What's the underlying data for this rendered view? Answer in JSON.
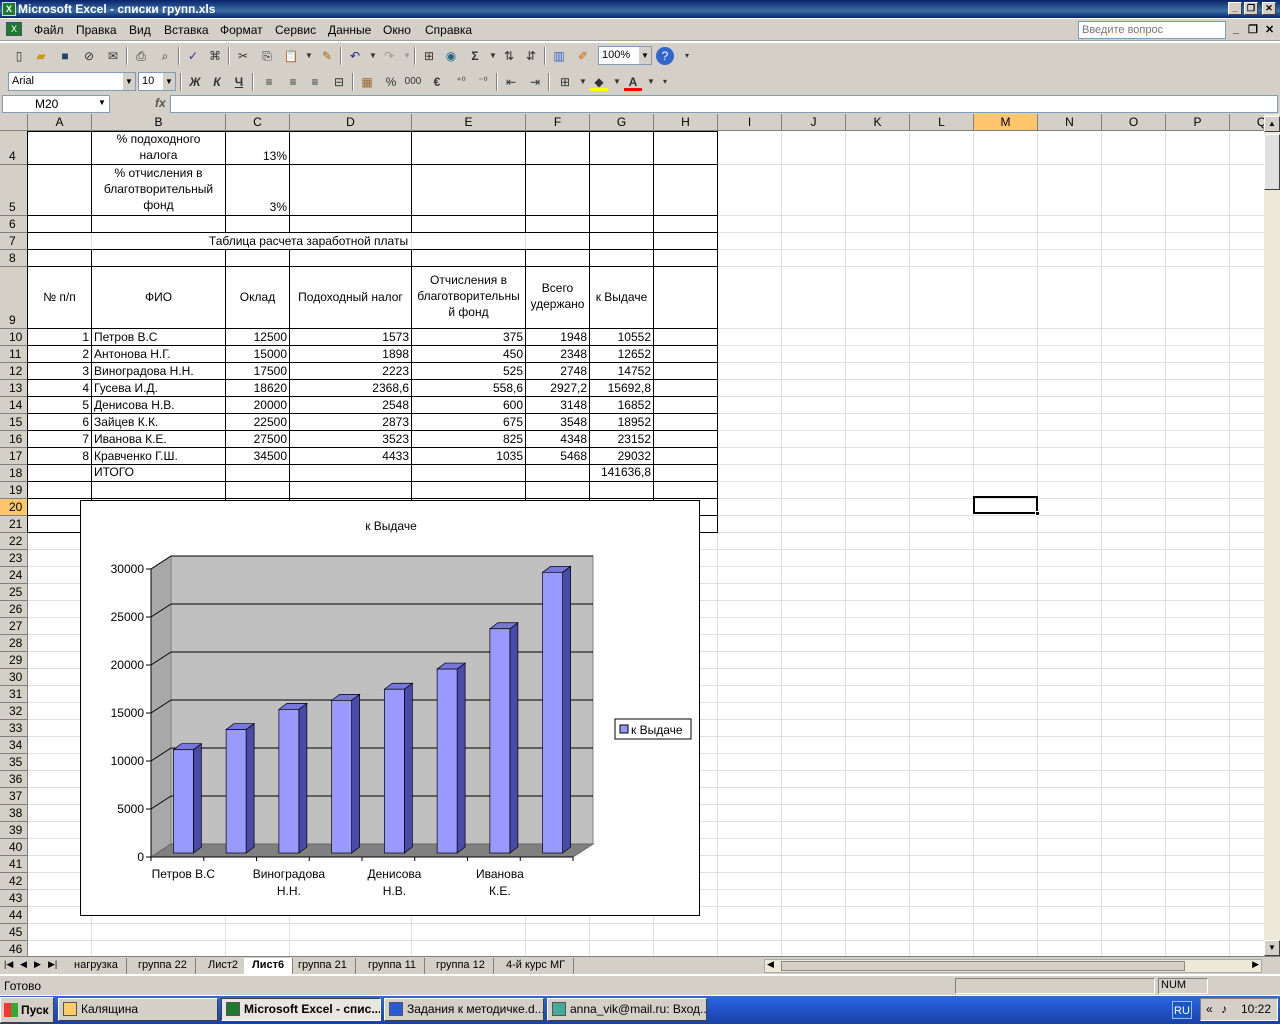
{
  "window": {
    "title": "Microsoft Excel - списки групп.xls",
    "minimize": "_",
    "restore": "❐",
    "close": "✕"
  },
  "menu": {
    "items": [
      "Файл",
      "Правка",
      "Вид",
      "Вставка",
      "Формат",
      "Сервис",
      "Данные",
      "Окно",
      "Справка"
    ],
    "help_placeholder": "Введите вопрос"
  },
  "toolbar": {
    "zoom": "100%",
    "font": "Arial",
    "size": "10",
    "bold": "Ж",
    "italic": "К",
    "underline": "Ч",
    "percent": "%",
    "thousands": "000",
    "euro": "€",
    "sum": "Σ"
  },
  "formula_bar": {
    "name_box": "M20",
    "fx": "fx",
    "value": ""
  },
  "columns": [
    "A",
    "B",
    "C",
    "D",
    "E",
    "F",
    "G",
    "H",
    "I",
    "J",
    "K",
    "L",
    "M",
    "N",
    "O",
    "P",
    "Q"
  ],
  "rows": [
    "4",
    "5",
    "6",
    "7",
    "8",
    "9",
    "10",
    "11",
    "12",
    "13",
    "14",
    "15",
    "16",
    "17",
    "18",
    "19",
    "20",
    "21",
    "22",
    "23",
    "24",
    "25",
    "26",
    "27",
    "28",
    "29",
    "30",
    "31",
    "32",
    "33",
    "34",
    "35",
    "36",
    "37",
    "38",
    "39",
    "40",
    "41",
    "42",
    "43",
    "44",
    "45",
    "46"
  ],
  "params": {
    "tax_label_1": "% подоходного",
    "tax_label_2": "налога",
    "tax_value": "13%",
    "charity_label_1": "% отчисления в",
    "charity_label_2": "благотворительный",
    "charity_label_3": "фонд",
    "charity_value": "3%"
  },
  "table": {
    "title": "Таблица расчета заработной платы",
    "headers": {
      "num": "№ п/п",
      "fio": "ФИО",
      "salary": "Оклад",
      "tax": "Подоходный налог",
      "charity_1": "Отчисления в",
      "charity_2": "благотворительны",
      "charity_3": "й фонд",
      "withheld_1": "Всего",
      "withheld_2": "удержано",
      "payout": "к Выдаче"
    },
    "rows": [
      {
        "n": "1",
        "fio": "Петров В.С",
        "salary": "12500",
        "tax": "1573",
        "charity": "375",
        "withheld": "1948",
        "payout": "10552"
      },
      {
        "n": "2",
        "fio": "Антонова Н.Г.",
        "salary": "15000",
        "tax": "1898",
        "charity": "450",
        "withheld": "2348",
        "payout": "12652"
      },
      {
        "n": "3",
        "fio": "Виноградова Н.Н.",
        "salary": "17500",
        "tax": "2223",
        "charity": "525",
        "withheld": "2748",
        "payout": "14752"
      },
      {
        "n": "4",
        "fio": "Гусева И.Д.",
        "salary": "18620",
        "tax": "2368,6",
        "charity": "558,6",
        "withheld": "2927,2",
        "payout": "15692,8"
      },
      {
        "n": "5",
        "fio": "Денисова Н.В.",
        "salary": "20000",
        "tax": "2548",
        "charity": "600",
        "withheld": "3148",
        "payout": "16852"
      },
      {
        "n": "6",
        "fio": "Зайцев К.К.",
        "salary": "22500",
        "tax": "2873",
        "charity": "675",
        "withheld": "3548",
        "payout": "18952"
      },
      {
        "n": "7",
        "fio": "Иванова К.Е.",
        "salary": "27500",
        "tax": "3523",
        "charity": "825",
        "withheld": "4348",
        "payout": "23152"
      },
      {
        "n": "8",
        "fio": "Кравченко Г.Ш.",
        "salary": "34500",
        "tax": "4433",
        "charity": "1035",
        "withheld": "5468",
        "payout": "29032"
      }
    ],
    "total_label": "ИТОГО",
    "total_value": "141636,8"
  },
  "chart_data": {
    "type": "bar",
    "title": "к Выдаче",
    "categories": [
      "Петров В.С",
      "Антонова Н.Г.",
      "Виноградова Н.Н.",
      "Гусева И.Д.",
      "Денисова Н.В.",
      "Зайцев К.К.",
      "Иванова К.Е.",
      "Кравченко Г.Ш."
    ],
    "x_tick_labels": [
      [
        "Петров В.С"
      ],
      [
        "Виноградова",
        "Н.Н."
      ],
      [
        "Денисова",
        "Н.В."
      ],
      [
        "Иванова",
        "К.Е."
      ]
    ],
    "series": [
      {
        "name": "к Выдаче",
        "values": [
          10552,
          12652,
          14752,
          15692.8,
          16852,
          18952,
          23152,
          29032
        ]
      }
    ],
    "ylim": [
      0,
      30000
    ],
    "yticks": [
      "0",
      "5000",
      "10000",
      "15000",
      "20000",
      "25000",
      "30000"
    ],
    "legend": "right",
    "grid": true,
    "style": "3d",
    "bar_color": "#9999ff"
  },
  "sheet_tabs": [
    "нагрузка",
    "группа 22",
    "Лист2",
    "Лист6",
    "группа 21",
    "группа 11",
    "группа 12",
    "4-й курс МГ"
  ],
  "active_tab": "Лист6",
  "status": {
    "ready": "Готово",
    "num": "NUM"
  },
  "taskbar": {
    "start": "Пуск",
    "tasks": [
      "Калящина",
      "Microsoft Excel - спис...",
      "Задания к методичке.d...",
      "anna_vik@mail.ru: Вход..."
    ],
    "lang": "RU",
    "time": "10:22"
  }
}
